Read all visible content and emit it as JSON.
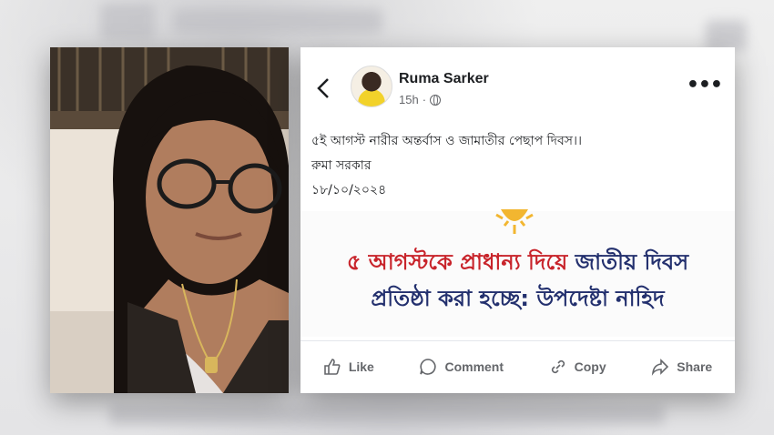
{
  "post": {
    "author": "Ruma Sarker",
    "time": "15h",
    "dot": "·",
    "text_lines": [
      "৫ই আগস্ট নারীর অন্তর্বাস ও জামাতীর পেছাপ দিবস।।",
      "রুমা সরকার",
      "১৮/১০/২০২৪"
    ]
  },
  "headline": {
    "line1_red": "৫ আগস্টকে প্রাধান্য দিয়ে",
    "line1_blue": "জাতীয় দিবস",
    "line2": "প্রতিষ্ঠা করা হচ্ছে: উপদেষ্টা নাহিদ"
  },
  "actions": {
    "like": "Like",
    "comment": "Comment",
    "copy": "Copy",
    "share": "Share"
  },
  "icons": [
    "back-icon",
    "avatar",
    "globe-icon",
    "more-icon",
    "sun-icon",
    "like-icon",
    "comment-icon",
    "copy-icon",
    "share-icon"
  ],
  "colors": {
    "headline_red": "#c8242b",
    "headline_blue": "#23306e",
    "muted": "#65676b"
  }
}
